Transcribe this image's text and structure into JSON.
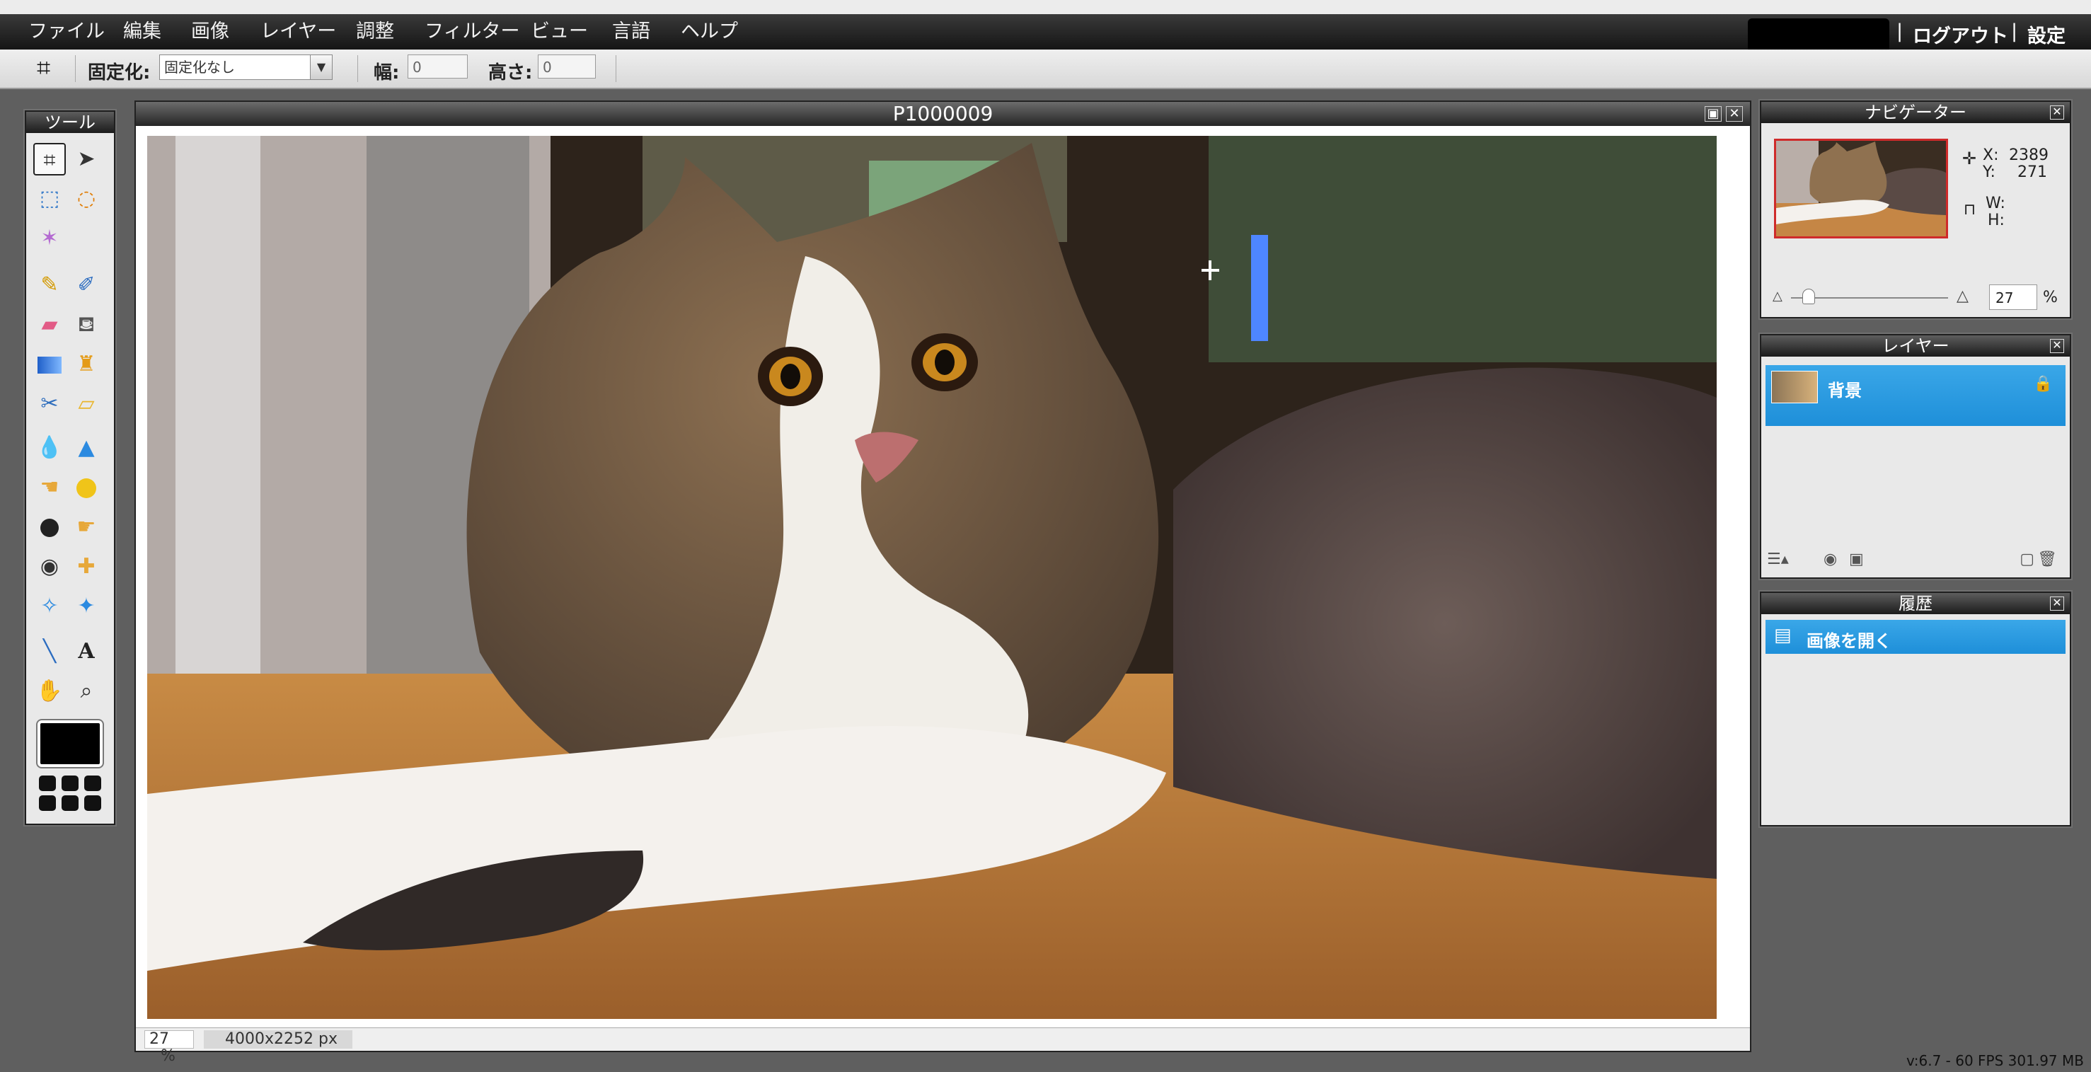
{
  "menu": {
    "items": [
      "ファイル",
      "編集",
      "画像",
      "レイヤー",
      "調整",
      "フィルター",
      "ビュー",
      "言語",
      "ヘルプ"
    ],
    "logout": "ログアウト",
    "settings": "設定",
    "separator": "|"
  },
  "options": {
    "constrain_label": "固定化:",
    "constrain_value": "固定化なし",
    "width_label": "幅:",
    "width_value": "0",
    "height_label": "高さ:",
    "height_value": "0"
  },
  "tools": {
    "title": "ツール",
    "items": [
      "crop-icon",
      "move-icon",
      "marquee-icon",
      "lasso-icon",
      "magic-wand-icon",
      "pencil-icon",
      "brush-icon",
      "eraser-icon",
      "paint-bucket-icon",
      "gradient-icon",
      "clone-stamp-icon",
      "color-replace-icon",
      "drawing-icon",
      "blur-icon",
      "sharpen-icon",
      "smudge-icon",
      "sponge-icon",
      "burn-icon",
      "dodge-icon",
      "red-eye-icon",
      "spot-heal-icon",
      "bloat-icon",
      "pinch-icon",
      "color-picker-icon",
      "type-icon",
      "hand-icon",
      "zoom-icon"
    ],
    "foreground_color": "#000000"
  },
  "document": {
    "title": "P1000009",
    "zoom": "27",
    "zoom_unit": "%",
    "dimensions": "4000x2252 px"
  },
  "navigator": {
    "title": "ナビゲーター",
    "x_label": "X:",
    "x_value": "2389",
    "y_label": "Y:",
    "y_value": "271",
    "w_label": "W:",
    "h_label": "H:",
    "zoom_value": "27",
    "zoom_unit": "%"
  },
  "layers": {
    "title": "レイヤー",
    "items": [
      "背景"
    ]
  },
  "history": {
    "title": "履歴",
    "items": [
      "画像を開く"
    ]
  },
  "footer": {
    "version": "v:6.7 - 60 FPS 301.97 MB"
  },
  "colors": {
    "accent": "#2a9ae1",
    "menubar": "#1c1c1c",
    "workspace": "#5f5f5f"
  }
}
